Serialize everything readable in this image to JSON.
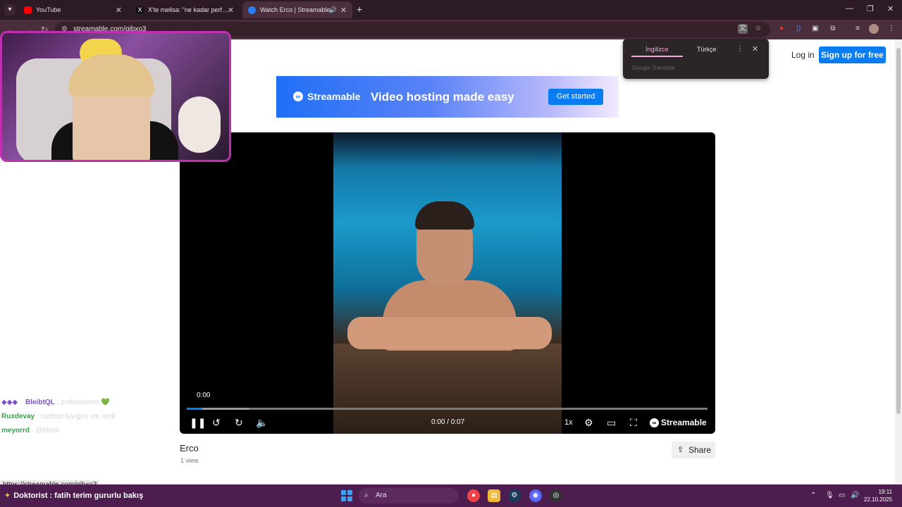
{
  "browser": {
    "tabs": [
      {
        "title": "YouTube",
        "color": "#ff0000",
        "active": false
      },
      {
        "title": "X'te melisa: \"ne kadar performa",
        "color": "#111111",
        "active": false
      },
      {
        "title": "Watch Erco | Streamable",
        "color": "#2d7ef7",
        "active": true
      }
    ],
    "url": "streamable.com/gjbxo3"
  },
  "header": {
    "login": "Log in",
    "signup": "Sign up for free"
  },
  "translate_popup": {
    "source_lang": "İngilizce",
    "target_lang": "Türkçe",
    "provider": "Google Translate"
  },
  "banner": {
    "brand": "Streamable",
    "tagline": "Video hosting made easy",
    "cta": "Get started"
  },
  "player": {
    "timestamp": "0:00",
    "time_display": "0:00 / 0:07",
    "speed": "1x",
    "brand": "Streamable",
    "progress": 0.03,
    "buffered": 0.12
  },
  "video": {
    "title": "Erco",
    "views": "1 view",
    "share": "Share"
  },
  "chat": [
    {
      "user": "BleibtQL",
      "msg": "zorbasinnnn 💚",
      "color": "#7d4fd1"
    },
    {
      "user": "Ruxdevay",
      "msg": "sadece bıyıgını var amk",
      "color": "#2fa64a"
    },
    {
      "user": "meyorrd",
      "msg": "@blush",
      "color": "#2fa64a"
    }
  ],
  "hover_url": "https://streamable.com/gjbxo3",
  "taskbar": {
    "chat_line": "Doktorist : fatih terim gururlu bakış",
    "search_placeholder": "Ara",
    "time": "19:11",
    "date": "22.10.2025"
  }
}
